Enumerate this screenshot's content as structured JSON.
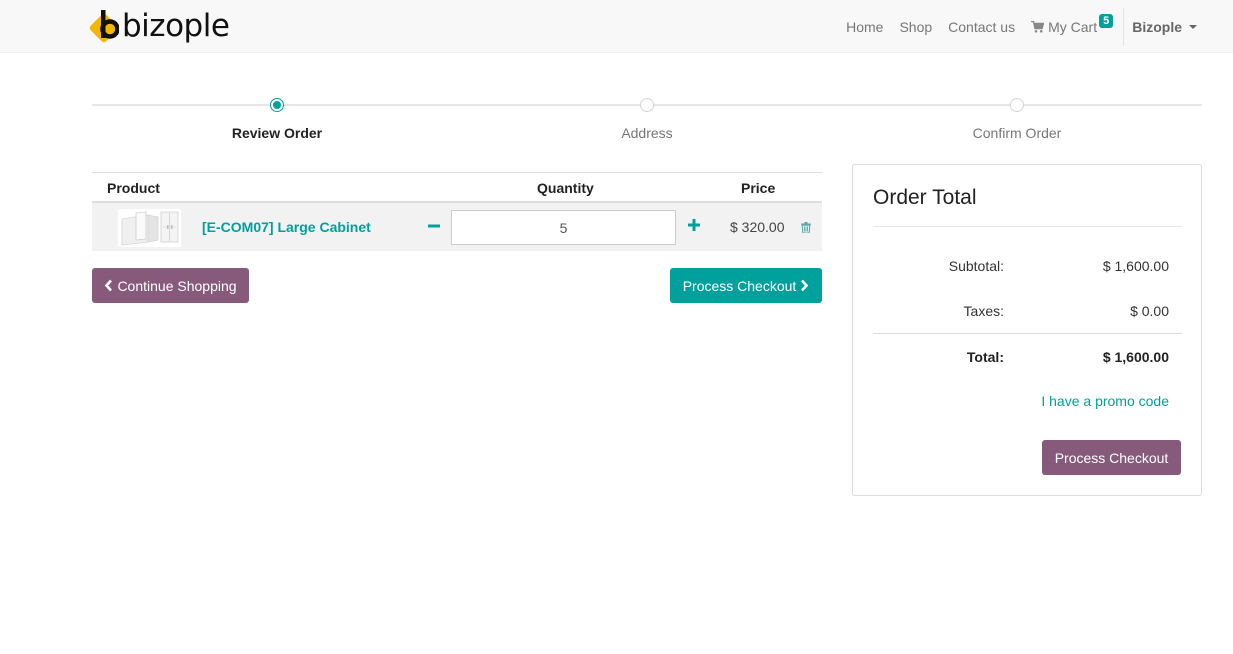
{
  "nav": {
    "brand": "bizople",
    "links": [
      "Home",
      "Shop",
      "Contact us"
    ],
    "cart_label": "My Cart",
    "cart_count": "5",
    "user": "Bizople"
  },
  "wizard": {
    "steps": [
      {
        "label": "Review Order",
        "active": true
      },
      {
        "label": "Address",
        "active": false
      },
      {
        "label": "Confirm Order",
        "active": false
      }
    ]
  },
  "cart": {
    "headers": {
      "product": "Product",
      "quantity": "Quantity",
      "price": "Price"
    },
    "items": [
      {
        "name": "[E-COM07] Large Cabinet",
        "quantity": "5",
        "price": "$ 320.00"
      }
    ],
    "continue_label": "Continue Shopping",
    "checkout_label": "Process Checkout"
  },
  "order_total": {
    "title": "Order Total",
    "subtotal_label": "Subtotal:",
    "subtotal_value": "$ 1,600.00",
    "taxes_label": "Taxes:",
    "taxes_value": "$ 0.00",
    "total_label": "Total:",
    "total_value": "$ 1,600.00",
    "promo_label": "I have a promo code",
    "checkout_label": "Process Checkout"
  },
  "colors": {
    "primary": "#875a7b",
    "accent": "#00a09d",
    "logo_accent": "#f2b705"
  },
  "icons": [
    "cart-icon",
    "minus-icon",
    "plus-icon",
    "trash-icon",
    "chevron-left-icon",
    "chevron-right-icon",
    "caret-down-icon"
  ]
}
